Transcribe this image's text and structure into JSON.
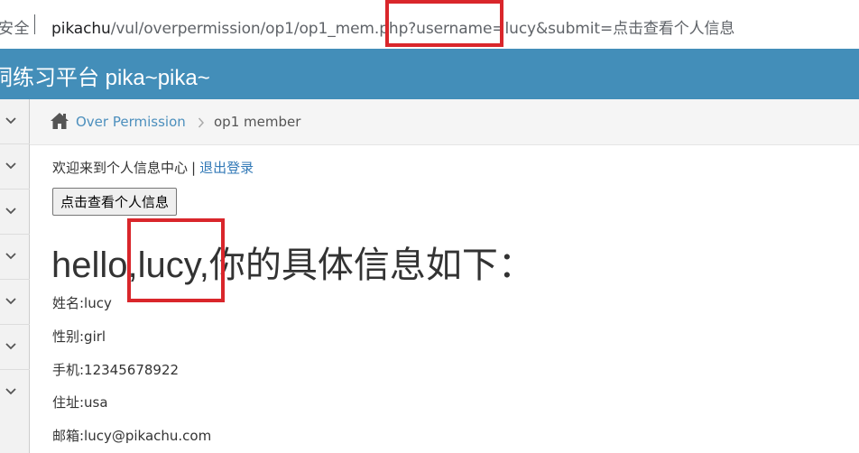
{
  "address_bar": {
    "security_text": "安全",
    "url_host": "pikachu",
    "url_rest": "/vul/overpermission/op1/op1_mem.php?username=lucy&submit=点击查看个人信息"
  },
  "header": {
    "brand": "洞练习平台 pika~pika~",
    "background_color": "#438eb9"
  },
  "sidebar": {
    "items": [
      {
        "icon": "chevron-down-icon"
      },
      {
        "icon": "chevron-down-icon"
      },
      {
        "icon": "chevron-down-icon"
      },
      {
        "icon": "chevron-down-icon"
      },
      {
        "icon": "chevron-down-icon"
      },
      {
        "icon": "chevron-down-icon"
      },
      {
        "icon": "chevron-down-icon"
      }
    ]
  },
  "breadcrumb": {
    "home_icon": "home-icon",
    "link": "Over Permission",
    "current": "op1 member"
  },
  "main": {
    "welcome_text": "欢迎来到个人信息中心",
    "separator": "|",
    "logout_link": "退出登录",
    "query_button": "点击查看个人信息",
    "greeting": "hello,lucy,你的具体信息如下：",
    "fields": [
      "姓名:lucy",
      "性别:girl",
      "手机:12345678922",
      "住址:usa",
      "邮箱:lucy@pikachu.com"
    ]
  },
  "annotation_color": "#d9262b"
}
